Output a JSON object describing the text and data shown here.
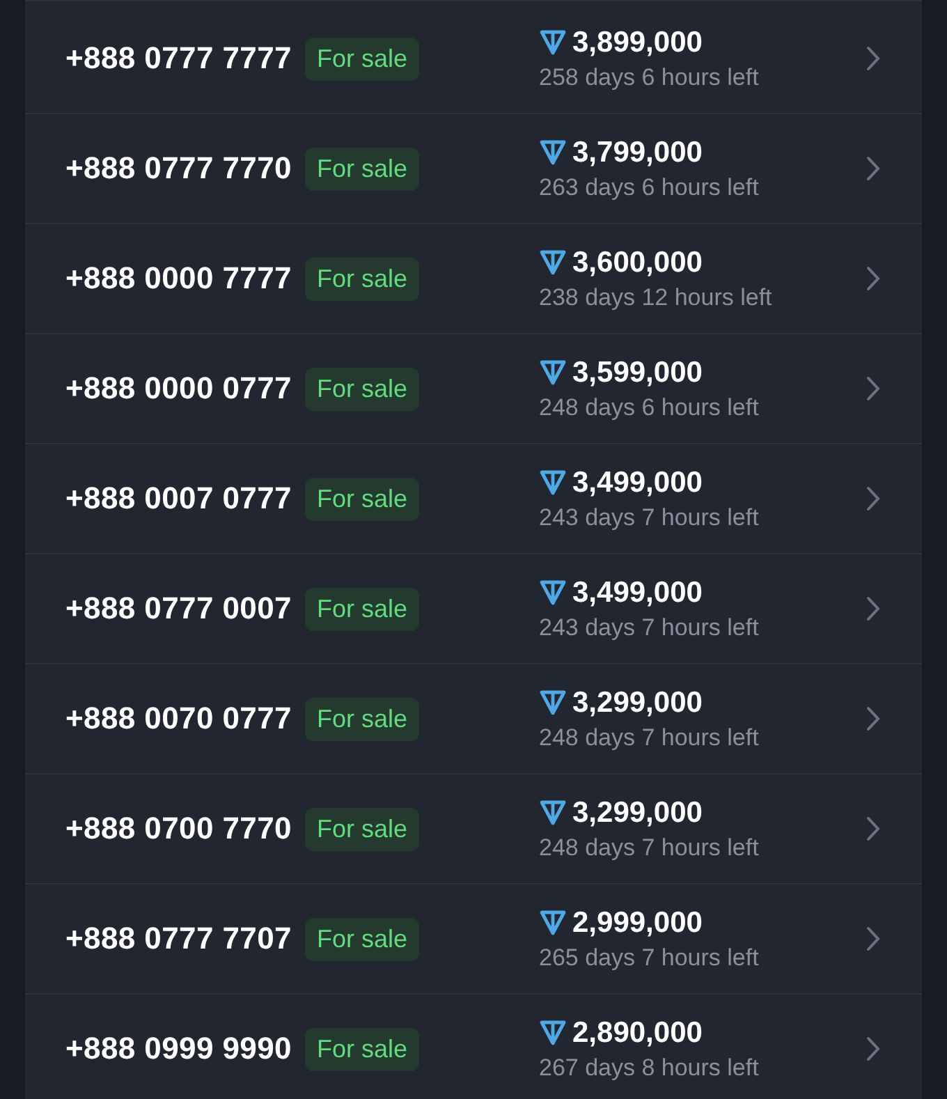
{
  "listings": [
    {
      "number": "+888 0777 7777",
      "status": "For sale",
      "price": "3,899,000",
      "time_left": "258 days 6 hours left"
    },
    {
      "number": "+888 0777 7770",
      "status": "For sale",
      "price": "3,799,000",
      "time_left": "263 days 6 hours left"
    },
    {
      "number": "+888 0000 7777",
      "status": "For sale",
      "price": "3,600,000",
      "time_left": "238 days 12 hours left"
    },
    {
      "number": "+888 0000 0777",
      "status": "For sale",
      "price": "3,599,000",
      "time_left": "248 days 6 hours left"
    },
    {
      "number": "+888 0007 0777",
      "status": "For sale",
      "price": "3,499,000",
      "time_left": "243 days 7 hours left"
    },
    {
      "number": "+888 0777 0007",
      "status": "For sale",
      "price": "3,499,000",
      "time_left": "243 days 7 hours left"
    },
    {
      "number": "+888 0070 0777",
      "status": "For sale",
      "price": "3,299,000",
      "time_left": "248 days 7 hours left"
    },
    {
      "number": "+888 0700 7770",
      "status": "For sale",
      "price": "3,299,000",
      "time_left": "248 days 7 hours left"
    },
    {
      "number": "+888 0777 7707",
      "status": "For sale",
      "price": "2,999,000",
      "time_left": "265 days 7 hours left"
    },
    {
      "number": "+888 0999 9990",
      "status": "For sale",
      "price": "2,890,000",
      "time_left": "267 days 8 hours left"
    }
  ]
}
